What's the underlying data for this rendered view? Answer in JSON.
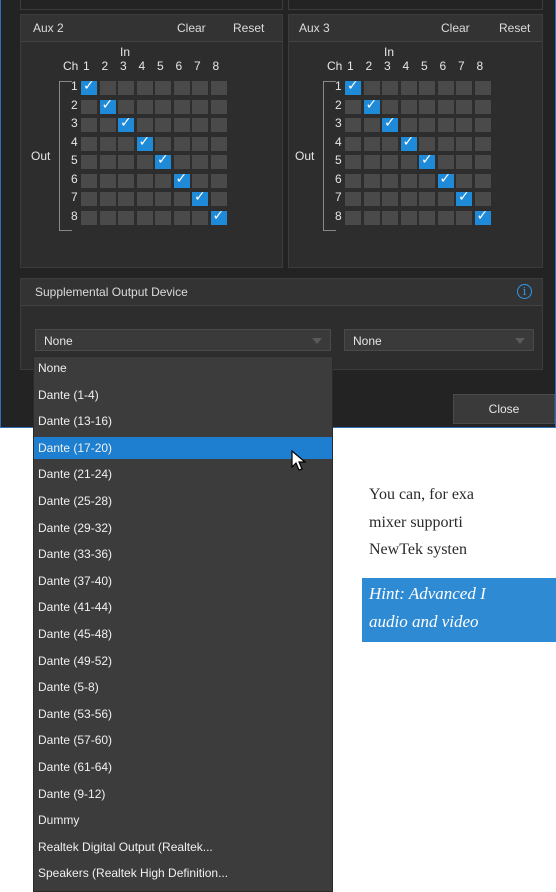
{
  "aux2": {
    "title": "Aux 2",
    "clear_label": "Clear",
    "reset_label": "Reset"
  },
  "aux3": {
    "title": "Aux 3",
    "clear_label": "Clear",
    "reset_label": "Reset"
  },
  "matrix": {
    "in_label": "In",
    "ch_label": "Ch",
    "out_label": "Out",
    "columns": [
      "1",
      "2",
      "3",
      "4",
      "5",
      "6",
      "7",
      "8"
    ],
    "rows": [
      "1",
      "2",
      "3",
      "4",
      "5",
      "6",
      "7",
      "8"
    ]
  },
  "supplemental": {
    "title": "Supplemental Output Device",
    "info_icon": "info-icon",
    "select1_value": "None",
    "select2_value": "None"
  },
  "close_label": "Close",
  "dropdown_options": [
    "None",
    "Dante (1-4)",
    "Dante (13-16)",
    "Dante (17-20)",
    "Dante (21-24)",
    "Dante (25-28)",
    "Dante (29-32)",
    "Dante (33-36)",
    "Dante (37-40)",
    "Dante (41-44)",
    "Dante (45-48)",
    "Dante (49-52)",
    "Dante (5-8)",
    "Dante (53-56)",
    "Dante (57-60)",
    "Dante (61-64)",
    "Dante (9-12)",
    "Dummy",
    "Realtek Digital Output (Realtek...",
    "Speakers (Realtek High Definition..."
  ],
  "selected_option": "Dante (17-20)",
  "doc": {
    "line1": "You can, for exa",
    "line2": "mixer supporti",
    "line3": "NewTek systen",
    "hint1": "Hint: Advanced I",
    "hint2": "audio and video"
  },
  "colors": {
    "accent": "#1e8ad8",
    "panel_bg": "#2d2d2d",
    "window_border": "#2a6fb8"
  }
}
